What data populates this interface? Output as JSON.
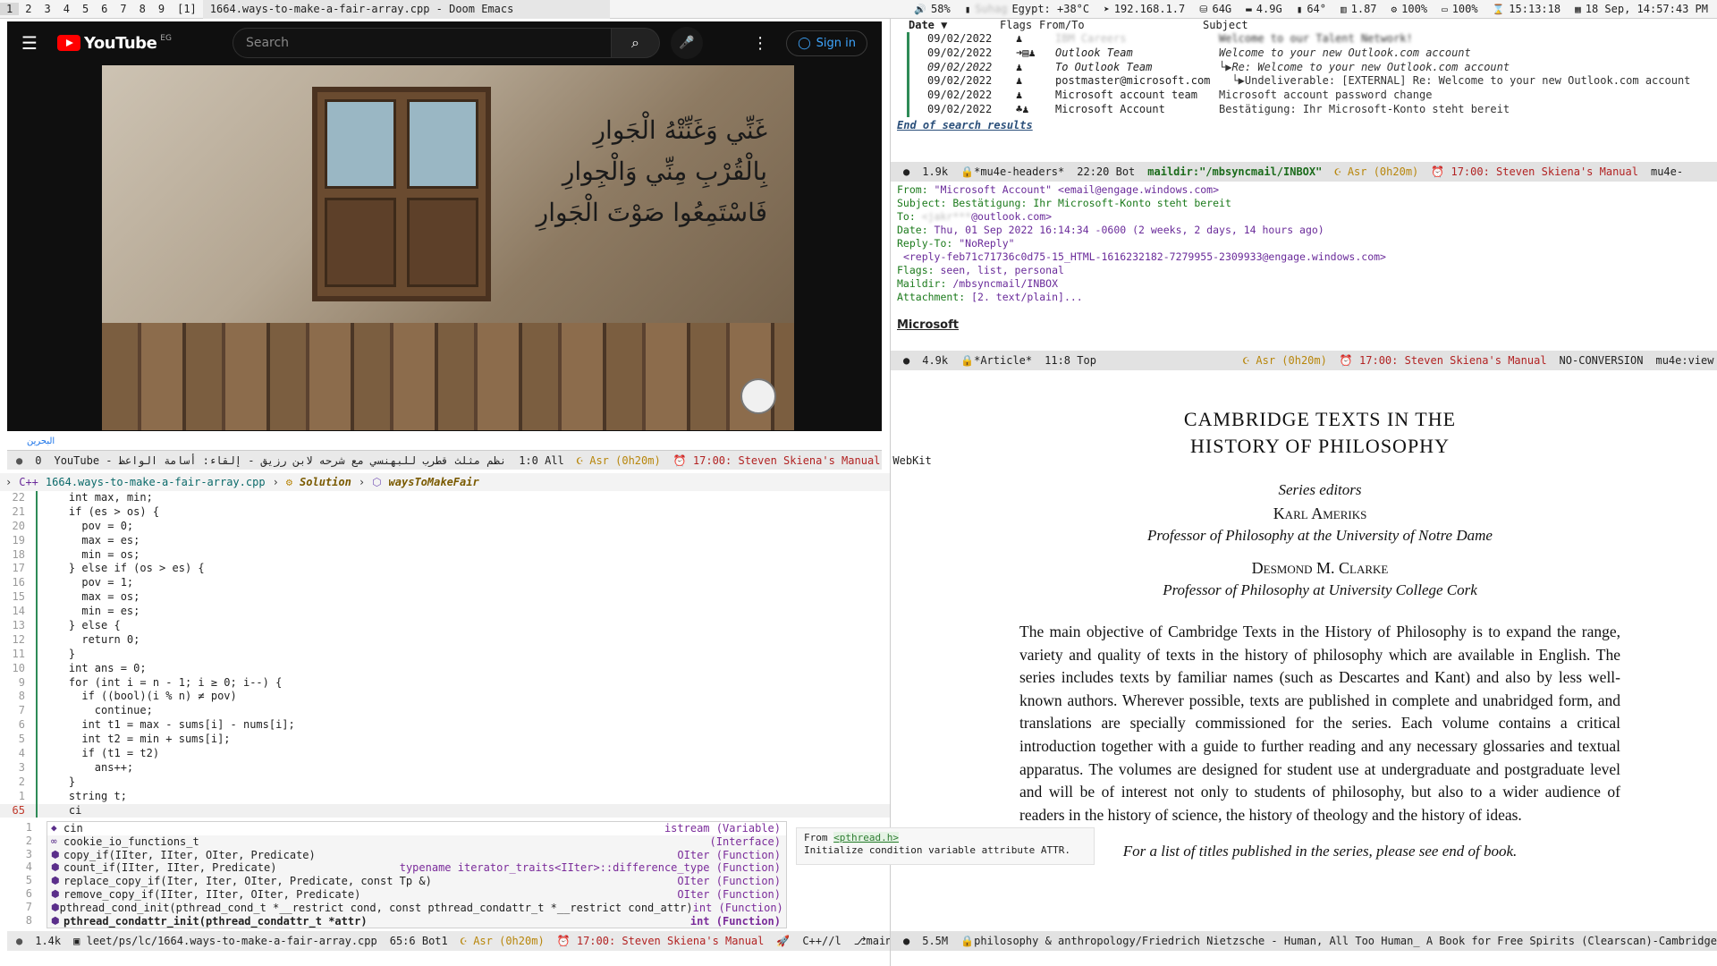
{
  "topbar": {
    "workspaces": [
      "1",
      "2",
      "3",
      "4",
      "5",
      "6",
      "7",
      "8",
      "9",
      "[1]"
    ],
    "window_title": "1664.ways-to-make-a-fair-array.cpp - Doom Emacs",
    "volume": "58%",
    "weather": "Egypt: +38°C",
    "weather_loc": "Suhag",
    "ip": "192.168.1.7",
    "disk": "64G",
    "mem": "4.9G",
    "temp": "64°",
    "load": "1.87",
    "cpu": "100%",
    "battery": "100%",
    "time": "15:13:18",
    "date": "18 Sep, 14:57:43 PM"
  },
  "youtube": {
    "logo": "YouTube",
    "region": "EG",
    "search_placeholder": "Search",
    "sign_in": "Sign in",
    "verses": [
      "غَنِّي وَغَنِّتْهُ الْجَوارِ",
      "بِالْقُرْبِ مِنِّي وَالْجِوارِ",
      "فَاسْتَمِعُوا صَوْتَ الْجَوارِ"
    ],
    "below_text": "البحرين"
  },
  "modeline_yt": {
    "left": "0",
    "title": "نظم مثلث قطرب للبهنسي مع شرحه لابن رزيق - إلقاء: أسامة الواعظ - YouTube",
    "pos": "1:0 All",
    "prayer": "Asr (0h20m)",
    "alarm": "17:00: Steven Skiena's Manual",
    "mode": "WebKit"
  },
  "breadcrumb": {
    "file": "1664.ways-to-make-a-fair-array.cpp",
    "class": "Solution",
    "func": "waysToMakeFair"
  },
  "code": [
    {
      "n": "22",
      "t": "    int max, min;"
    },
    {
      "n": "21",
      "t": "    if (es > os) {"
    },
    {
      "n": "20",
      "t": "      pov = 0;"
    },
    {
      "n": "19",
      "t": "      max = es;"
    },
    {
      "n": "18",
      "t": "      min = os;"
    },
    {
      "n": "17",
      "t": "    } else if (os > es) {"
    },
    {
      "n": "16",
      "t": "      pov = 1;"
    },
    {
      "n": "15",
      "t": "      max = os;"
    },
    {
      "n": "14",
      "t": "      min = es;"
    },
    {
      "n": "13",
      "t": "    } else {"
    },
    {
      "n": "12",
      "t": "      return 0;"
    },
    {
      "n": "11",
      "t": "    }"
    },
    {
      "n": "10",
      "t": "    int ans = 0;"
    },
    {
      "n": "9",
      "t": "    for (int i = n - 1; i ≥ 0; i--) {"
    },
    {
      "n": "8",
      "t": "      if ((bool)(i % n) ≠ pov)"
    },
    {
      "n": "7",
      "t": "        continue;"
    },
    {
      "n": "6",
      "t": "      int t1 = max - sums[i] - nums[i];"
    },
    {
      "n": "5",
      "t": "      int t2 = min + sums[i];"
    },
    {
      "n": "4",
      "t": "      if (t1 = t2)"
    },
    {
      "n": "3",
      "t": "        ans++;"
    },
    {
      "n": "2",
      "t": "    }"
    },
    {
      "n": "1",
      "t": "    string t;"
    },
    {
      "n": "65",
      "t": "    ci"
    }
  ],
  "completion": {
    "line_numbers": [
      "1",
      "2",
      "3",
      "4",
      "5",
      "6",
      "7",
      "8"
    ],
    "items": [
      {
        "name": "cin",
        "type": "istream (Variable)"
      },
      {
        "name": "cookie_io_functions_t",
        "type": "(Interface)"
      },
      {
        "name": "copy_if(IIter, IIter, OIter, Predicate)",
        "type": "OIter (Function)"
      },
      {
        "name": "count_if(IIter, IIter, Predicate)",
        "type": "typename iterator_traits<IIter>::difference_type (Function)"
      },
      {
        "name": "replace_copy_if(Iter, Iter, OIter, Predicate, const Tp &)",
        "type": "OIter (Function)"
      },
      {
        "name": "remove_copy_if(IIter, IIter, OIter, Predicate)",
        "type": "OIter (Function)"
      },
      {
        "name": "pthread_cond_init(pthread_cond_t *__restrict cond, const pthread_condattr_t *__restrict cond_attr)",
        "type": "int (Function)"
      },
      {
        "name": "pthread_condattr_init(pthread_condattr_t *attr)",
        "type": "int (Function)"
      }
    ],
    "doc_from": "From ",
    "doc_header": "<pthread.h>",
    "doc_text": "Initialize condition variable attribute ATTR."
  },
  "modeline_code": {
    "size": "1.4k",
    "path": "leet/ps/lc/1664.ways-to-make-a-fair-array.cpp",
    "pos": "65:6 Bot1",
    "prayer": "Asr (0h20m)",
    "alarm": "17:00: Steven Skiena's Manual",
    "lang": "C++//l",
    "branch": "main"
  },
  "mail": {
    "headers": {
      "date": "Date ▼",
      "flags": "Flags",
      "from": "From/To",
      "subject": "Subject"
    },
    "rows": [
      {
        "date": "09/02/2022",
        "flags": "♟",
        "from": "IBM Careers",
        "subject": "Welcome to our Talent Network!",
        "blur": true
      },
      {
        "date": "09/02/2022",
        "flags": "➜▤♟",
        "from": "Outlook Team",
        "subject": "Welcome to your new Outlook.com account",
        "italic": true
      },
      {
        "date": "09/02/2022",
        "flags": "♟",
        "from": "To Outlook Team",
        "subject": "└▶Re: Welcome to your new Outlook.com account",
        "italic": true
      },
      {
        "date": "09/02/2022",
        "flags": "♟",
        "from": "postmaster@microsoft.com",
        "subject": "  └▶Undeliverable: [EXTERNAL] Re: Welcome to your new Outlook.com account"
      },
      {
        "date": "09/02/2022",
        "flags": "♟",
        "from": "Microsoft account team",
        "subject": "Microsoft account password change"
      },
      {
        "date": "09/02/2022",
        "flags": "♣♟",
        "from": "Microsoft Account",
        "subject": "Bestätigung: Ihr Microsoft-Konto steht bereit"
      }
    ],
    "end": "End of search results"
  },
  "modeline_headers": {
    "size": "1.9k",
    "name": "*mu4e-headers*",
    "pos": "22:20 Bot",
    "path": "maildir:\"/mbsyncmail/INBOX\"",
    "prayer": "Asr (0h20m)",
    "alarm": "17:00: Steven Skiena's Manual",
    "mode": "mu4e-"
  },
  "message": {
    "from_k": "From: ",
    "from_v": "\"Microsoft Account\" <email@engage.windows.com>",
    "subj_k": "Subject: ",
    "subj_v": "Bestätigung: Ihr Microsoft-Konto steht bereit",
    "to_k": "To: ",
    "to_v": "@outlook.com>",
    "date_k": "Date: ",
    "date_v": "Thu, 01 Sep 2022 16:14:34 -0600 (2 weeks, 2 days, 14 hours ago)",
    "reply_k": "Reply-To: ",
    "reply_v": "\"NoReply\"",
    "reply_addr": "<reply-feb71c71736c0d75-15_HTML-1616232182-7279955-2309933@engage.windows.com>",
    "flags_k": "Flags: ",
    "flags_v": "seen, list, personal",
    "maildir_k": "Maildir: ",
    "maildir_v": "/mbsyncmail/INBOX",
    "attach_k": "Attachment: ",
    "attach_v": "[2. text/plain]...",
    "body": "Microsoft"
  },
  "modeline_article": {
    "size": "4.9k",
    "name": "*Article*",
    "pos": "11:8 Top",
    "prayer": "Asr (0h20m)",
    "alarm": "17:00: Steven Skiena's Manual",
    "enc": "NO-CONVERSION",
    "mode": "mu4e:view"
  },
  "book": {
    "title1": "CAMBRIDGE TEXTS IN THE",
    "title2": "HISTORY OF PHILOSOPHY",
    "series": "Series editors",
    "ed1": "Karl Ameriks",
    "ed1_aff": "Professor of Philosophy at the University of Notre Dame",
    "ed2": "Desmond M. Clarke",
    "ed2_aff": "Professor of Philosophy at University College Cork",
    "para": "The main objective of Cambridge Texts in the History of Philosophy is to expand the range, variety and quality of texts in the history of philosophy which are available in English. The series includes texts by familiar names (such as Descartes and Kant) and also by less well-known authors. Wherever possible, texts are published in complete and unabridged form, and translations are specially commissioned for the series. Each volume contains a critical introduction together with a guide to further reading and any necessary glossaries and textual apparatus. The volumes are designed for student use at undergraduate and postgraduate level and will be of interest not only to students of philosophy, but also to a wider audience of readers in the history of science, the history of theology and the history of ideas.",
    "list": "For a list of titles published in the series, please see end of book."
  },
  "modeline_pdf": {
    "size": "5.5M",
    "path": "philosophy & anthropology/Friedrich Nietzsche - Human, All Too Human_ A Book for Free Spirits (Clearscan)-Cambridge U"
  }
}
